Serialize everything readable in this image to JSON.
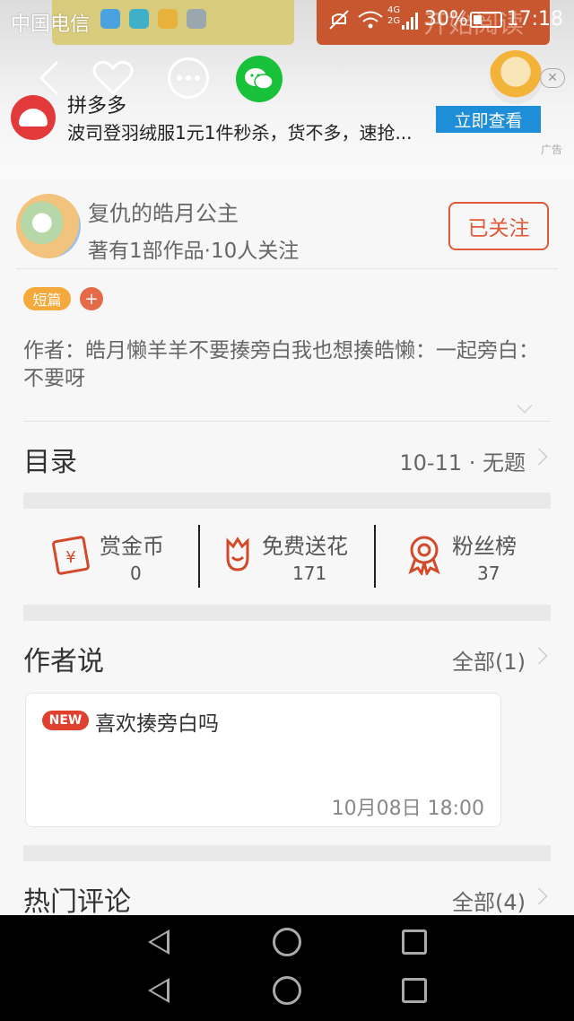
{
  "status_bar": {
    "carrier": "中国电信",
    "battery_percent": "30%",
    "time": "17:18",
    "network_top": "4G",
    "network_bottom": "2G"
  },
  "background_buttons": {
    "start_reading": "开始阅读"
  },
  "top_actions": {
    "back_icon": "chevron-left",
    "like_icon": "heart",
    "more_icon": "ellipsis",
    "share_icon": "wechat"
  },
  "ad": {
    "brand": "拼多多",
    "description": "波司登羽绒服1元1件秒杀，货不多，速抢...",
    "cta": "立即查看",
    "tag": "广告"
  },
  "author": {
    "name": "复仇的皓月公主",
    "meta": "著有1部作品·10人关注",
    "follow_label": "已关注"
  },
  "tags": {
    "short": "短篇",
    "add": "+"
  },
  "intro": "作者：皓月懒羊羊不要揍旁白我也想揍皓懒：一起旁白：不要呀",
  "toc": {
    "title": "目录",
    "latest": "10-11 · 无题"
  },
  "stats": [
    {
      "label": "赏金币",
      "value": "0",
      "icon": "reward-icon"
    },
    {
      "label": "免费送花",
      "value": "171",
      "icon": "flower-icon"
    },
    {
      "label": "粉丝榜",
      "value": "37",
      "icon": "medal-icon"
    }
  ],
  "author_says": {
    "title": "作者说",
    "all": "全部(1)",
    "note": {
      "badge": "NEW",
      "title": "喜欢揍旁白吗",
      "time": "10月08日  18:00"
    }
  },
  "hot_comments": {
    "title": "热门评论",
    "all": "全部(4)"
  },
  "colors": {
    "accent": "#e05a3a",
    "wechat": "#19c03a",
    "ad_button": "#1e8ed8",
    "tag_short": "#f3a93b"
  }
}
